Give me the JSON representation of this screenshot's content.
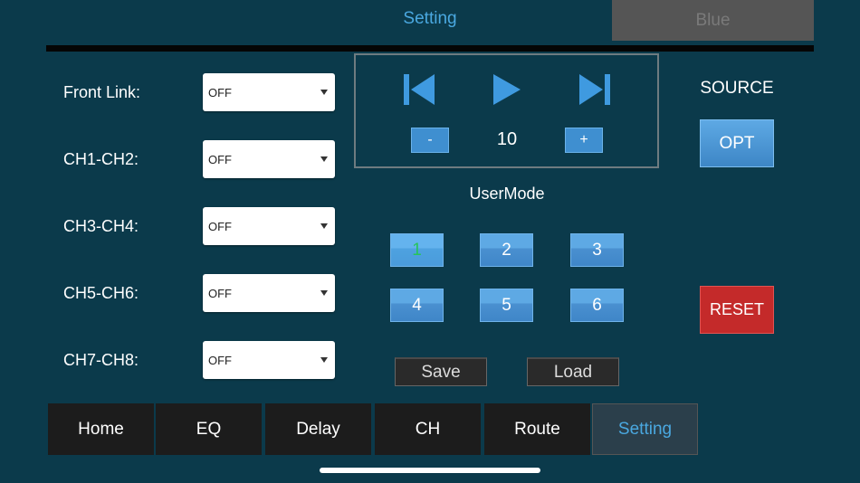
{
  "header": {
    "title": "Setting",
    "device": "Blue"
  },
  "rows": [
    {
      "label": "Front Link:",
      "value": "OFF"
    },
    {
      "label": "CH1-CH2:",
      "value": "OFF"
    },
    {
      "label": "CH3-CH4:",
      "value": "OFF"
    },
    {
      "label": "CH5-CH6:",
      "value": "OFF"
    },
    {
      "label": "CH7-CH8:",
      "value": "OFF"
    }
  ],
  "player": {
    "prev_icon": "skip-previous-icon",
    "play_icon": "play-icon",
    "next_icon": "skip-next-icon",
    "minus_label": "-",
    "plus_label": "+",
    "volume": "10"
  },
  "source": {
    "label": "SOURCE",
    "value": "OPT"
  },
  "usermode": {
    "label": "UserMode",
    "buttons": [
      "1",
      "2",
      "3",
      "4",
      "5",
      "6"
    ],
    "active": "1"
  },
  "reset_label": "RESET",
  "save_label": "Save",
  "load_label": "Load",
  "tabs": [
    "Home",
    "EQ",
    "Delay",
    "CH",
    "Route",
    "Setting"
  ],
  "active_tab": "Setting",
  "colors": {
    "background": "#0b3a4b",
    "accent": "#4aa8e0",
    "button_blue": "#4a90d0",
    "reset_red": "#c42a2a",
    "active_mode_text": "#27c45a"
  }
}
